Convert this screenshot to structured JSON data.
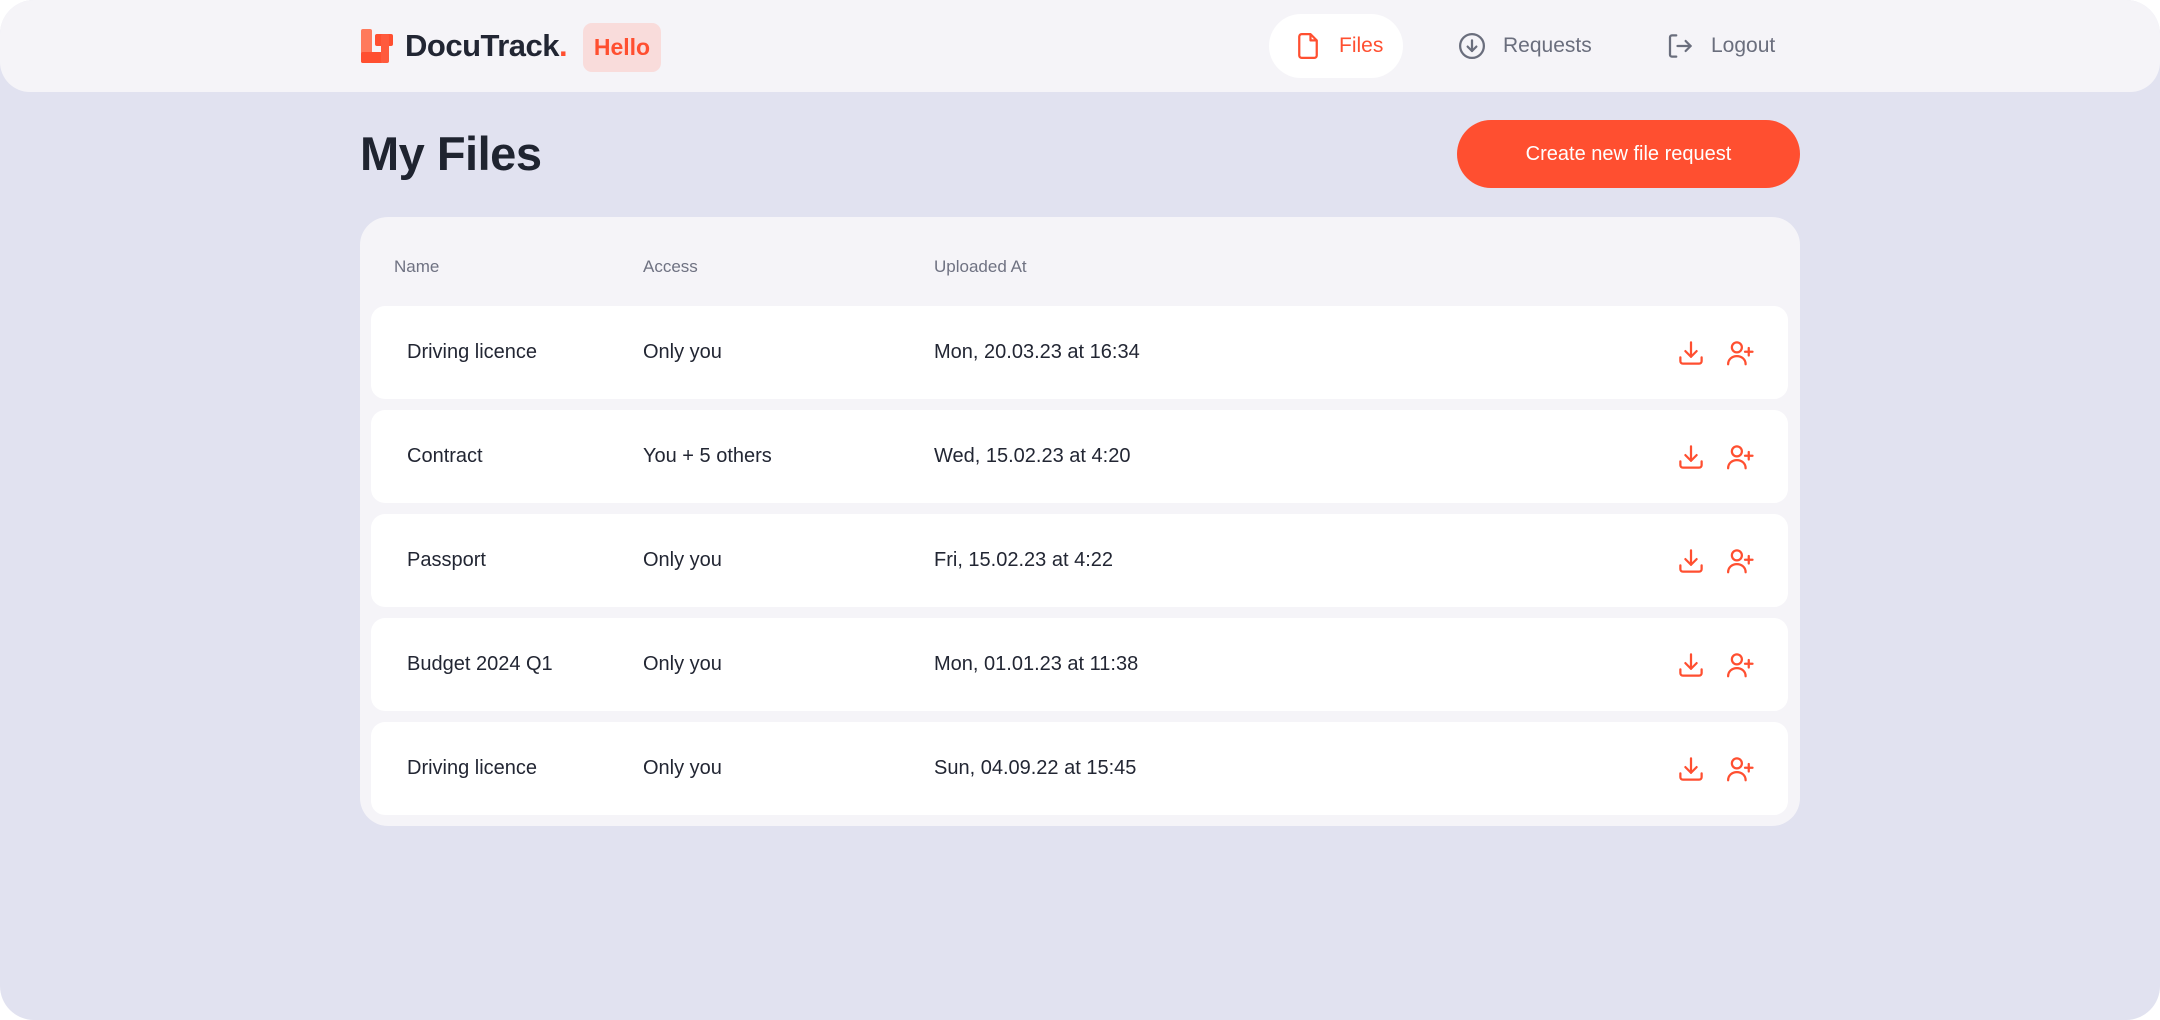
{
  "app": {
    "brand": "DocuTrack",
    "brand_dot": ".",
    "greeting": "Hello",
    "accent_color": "#ff4f30"
  },
  "nav": {
    "files": {
      "label": "Files",
      "icon": "file-icon",
      "active": true
    },
    "requests": {
      "label": "Requests",
      "icon": "arrow-down-circle-icon"
    },
    "logout": {
      "label": "Logout",
      "icon": "logout-icon"
    }
  },
  "main": {
    "title": "My Files",
    "create_button": "Create new file request"
  },
  "table": {
    "columns": {
      "name": "Name",
      "access": "Access",
      "uploaded_at": "Uploaded At"
    },
    "rows": [
      {
        "name": "Driving licence",
        "access": "Only you",
        "uploaded_at": "Mon, 20.03.23 at 16:34"
      },
      {
        "name": "Contract",
        "access": "You + 5 others",
        "uploaded_at": "Wed, 15.02.23 at 4:20"
      },
      {
        "name": "Passport",
        "access": "Only you",
        "uploaded_at": "Fri, 15.02.23 at 4:22"
      },
      {
        "name": "Budget 2024 Q1",
        "access": "Only you",
        "uploaded_at": "Mon, 01.01.23 at 11:38"
      },
      {
        "name": "Driving licence",
        "access": "Only you",
        "uploaded_at": "Sun, 04.09.22 at 15:45"
      }
    ],
    "row_actions": {
      "download_icon": "download-icon",
      "share_icon": "user-plus-icon"
    }
  }
}
